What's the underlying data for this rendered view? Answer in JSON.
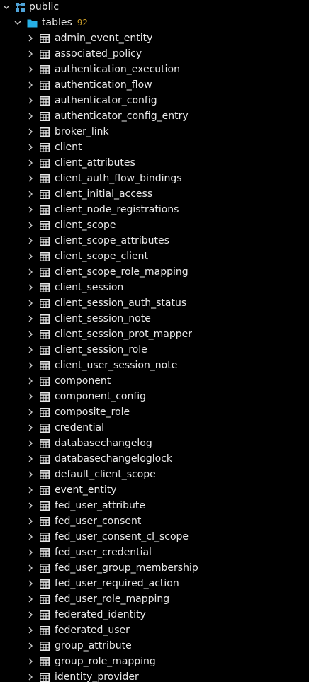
{
  "tree": {
    "schema": {
      "label": "public",
      "icon": "schema-icon",
      "expanded": true
    },
    "tables_folder": {
      "label": "tables",
      "count": "92",
      "icon": "folder-icon",
      "expanded": true
    },
    "tables": [
      "admin_event_entity",
      "associated_policy",
      "authentication_execution",
      "authentication_flow",
      "authenticator_config",
      "authenticator_config_entry",
      "broker_link",
      "client",
      "client_attributes",
      "client_auth_flow_bindings",
      "client_initial_access",
      "client_node_registrations",
      "client_scope",
      "client_scope_attributes",
      "client_scope_client",
      "client_scope_role_mapping",
      "client_session",
      "client_session_auth_status",
      "client_session_note",
      "client_session_prot_mapper",
      "client_session_role",
      "client_user_session_note",
      "component",
      "component_config",
      "composite_role",
      "credential",
      "databasechangelog",
      "databasechangeloglock",
      "default_client_scope",
      "event_entity",
      "fed_user_attribute",
      "fed_user_consent",
      "fed_user_consent_cl_scope",
      "fed_user_credential",
      "fed_user_group_membership",
      "fed_user_required_action",
      "fed_user_role_mapping",
      "federated_identity",
      "federated_user",
      "group_attribute",
      "group_role_mapping",
      "identity_provider"
    ]
  },
  "colors": {
    "background": "#000000",
    "text": "#e8e8e8",
    "chevron": "#c8c8c8",
    "schema_icon": "#4fa3d8",
    "folder_icon": "#27b0e6",
    "table_icon": "#e6e6e6",
    "count_badge": "#c69a28"
  }
}
